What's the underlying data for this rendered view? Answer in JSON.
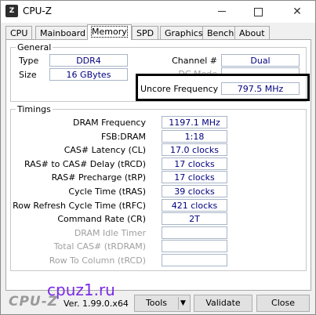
{
  "window": {
    "title": "CPU-Z",
    "app_icon": "Z"
  },
  "titlebar": {
    "minimize": "minimize-icon",
    "maximize": "maximize-icon",
    "close": "✕"
  },
  "tabs": [
    {
      "label": "CPU",
      "active": false
    },
    {
      "label": "Mainboard",
      "active": false
    },
    {
      "label": "Memory",
      "active": true
    },
    {
      "label": "SPD",
      "active": false
    },
    {
      "label": "Graphics",
      "active": false
    },
    {
      "label": "Bench",
      "active": false
    },
    {
      "label": "About",
      "active": false
    }
  ],
  "general": {
    "title": "General",
    "type_label": "Type",
    "type_value": "DDR4",
    "size_label": "Size",
    "size_value": "16 GBytes",
    "channel_label": "Channel #",
    "channel_value": "Dual",
    "dc_mode_label": "DC Mode",
    "dc_mode_value": "",
    "uncore_label": "Uncore Frequency",
    "uncore_value": "797.5 MHz"
  },
  "timings": {
    "title": "Timings",
    "rows": [
      {
        "label": "DRAM Frequency",
        "value": "1197.1 MHz",
        "enabled": true
      },
      {
        "label": "FSB:DRAM",
        "value": "1:18",
        "enabled": true
      },
      {
        "label": "CAS# Latency (CL)",
        "value": "17.0 clocks",
        "enabled": true
      },
      {
        "label": "RAS# to CAS# Delay (tRCD)",
        "value": "17 clocks",
        "enabled": true
      },
      {
        "label": "RAS# Precharge (tRP)",
        "value": "17 clocks",
        "enabled": true
      },
      {
        "label": "Cycle Time (tRAS)",
        "value": "39 clocks",
        "enabled": true
      },
      {
        "label": "Row Refresh Cycle Time (tRFC)",
        "value": "421 clocks",
        "enabled": true
      },
      {
        "label": "Command Rate (CR)",
        "value": "2T",
        "enabled": true
      },
      {
        "label": "DRAM Idle Timer",
        "value": "",
        "enabled": false
      },
      {
        "label": "Total CAS# (tRDRAM)",
        "value": "",
        "enabled": false
      },
      {
        "label": "Row To Column (tRCD)",
        "value": "",
        "enabled": false
      }
    ]
  },
  "watermark": "cpuz1.ru",
  "footer": {
    "brand": "CPU-Z",
    "version": "Ver. 1.99.0.x64",
    "tools_label": "Tools",
    "tools_arrow": "▼",
    "validate_label": "Validate",
    "close_label": "Close"
  }
}
